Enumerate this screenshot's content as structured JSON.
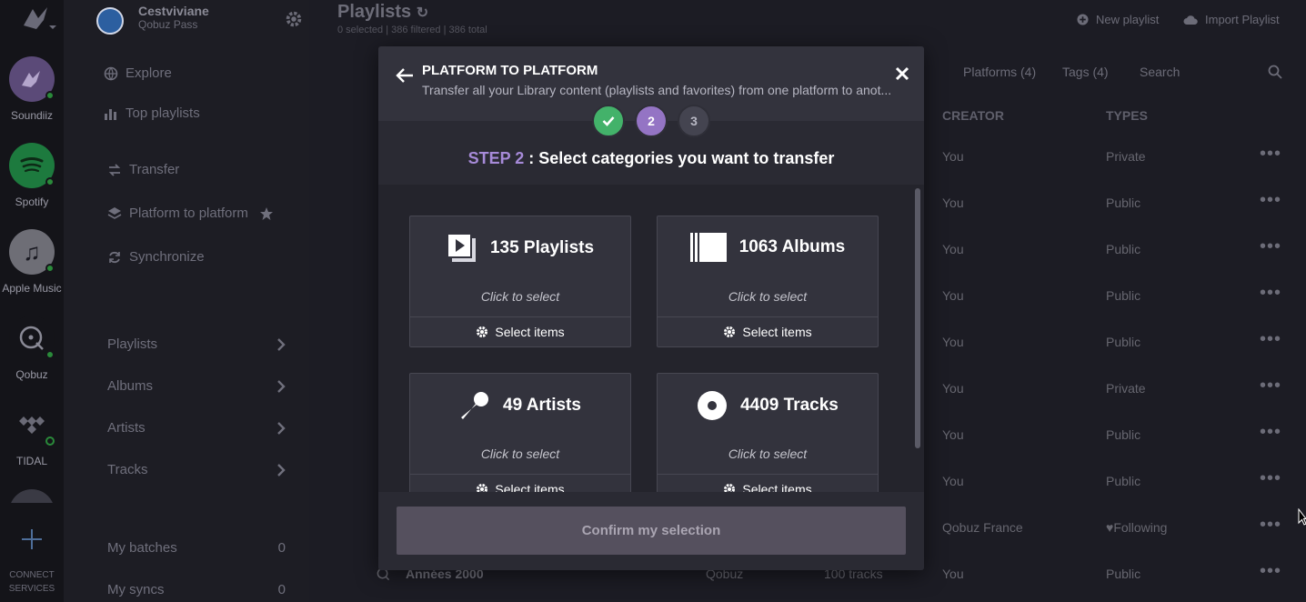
{
  "rail": {
    "platforms": [
      {
        "label": "Soundiiz",
        "icon": "soundiiz-icon"
      },
      {
        "label": "Spotify",
        "icon": "spotify-icon"
      },
      {
        "label": "Apple Music",
        "icon": "apple-music-icon"
      },
      {
        "label": "Qobuz",
        "icon": "qobuz-icon"
      },
      {
        "label": "TIDAL",
        "icon": "tidal-icon"
      }
    ],
    "connect_label_1": "CONNECT",
    "connect_label_2": "SERVICES"
  },
  "sidebar": {
    "user_name": "Cestviviane",
    "user_plan": "Qobuz Pass",
    "nav": {
      "explore": "Explore",
      "top_playlists": "Top playlists",
      "transfer": "Transfer",
      "platform_to_platform": "Platform to platform",
      "synchronize": "Synchronize"
    },
    "library": {
      "playlists": "Playlists",
      "albums": "Albums",
      "artists": "Artists",
      "tracks": "Tracks"
    },
    "automation": {
      "my_batches": "My batches",
      "my_batches_count": "0",
      "my_syncs": "My syncs",
      "my_syncs_count": "0"
    }
  },
  "header": {
    "title": "Playlists",
    "subtitle": "0 selected | 386 filtered | 386 total",
    "new_playlist": "New playlist",
    "import_playlist": "Import Playlist"
  },
  "filters": {
    "platforms": "Platforms (4)",
    "tags": "Tags (4)",
    "search_placeholder": "Search"
  },
  "table": {
    "col_creator": "CREATOR",
    "col_types": "TYPES",
    "rows": [
      {
        "creator": "You",
        "type": "Private"
      },
      {
        "creator": "You",
        "type": "Public"
      },
      {
        "creator": "You",
        "type": "Public"
      },
      {
        "creator": "You",
        "type": "Public"
      },
      {
        "creator": "You",
        "type": "Public"
      },
      {
        "creator": "You",
        "type": "Private"
      },
      {
        "creator": "You",
        "type": "Public"
      },
      {
        "creator": "You",
        "type": "Public"
      },
      {
        "creator": "Qobuz France",
        "type": "♥Following"
      },
      {
        "name": "Années 2000",
        "platform": "Qobuz",
        "tracks": "100 tracks",
        "creator": "You",
        "type": "Public"
      }
    ]
  },
  "modal": {
    "title": "PLATFORM TO PLATFORM",
    "description": "Transfer all your Library content (playlists and favorites) from one platform to anot...",
    "steps": {
      "step2": "2",
      "step3": "3"
    },
    "step_prefix": "STEP 2",
    "step_text": " : Select categories you want to transfer",
    "cards": [
      {
        "title": "135 Playlists",
        "hint": "Click to select",
        "select": "Select items"
      },
      {
        "title": "1063 Albums",
        "hint": "Click to select",
        "select": "Select items"
      },
      {
        "title": "49 Artists",
        "hint": "Click to select",
        "select": "Select items"
      },
      {
        "title": "4409 Tracks",
        "hint": "Click to select",
        "select": "Select items"
      }
    ],
    "confirm": "Confirm my selection"
  },
  "colors": {
    "accent": "#9474c4",
    "success": "#43b26a",
    "background": "#1c1c24"
  }
}
